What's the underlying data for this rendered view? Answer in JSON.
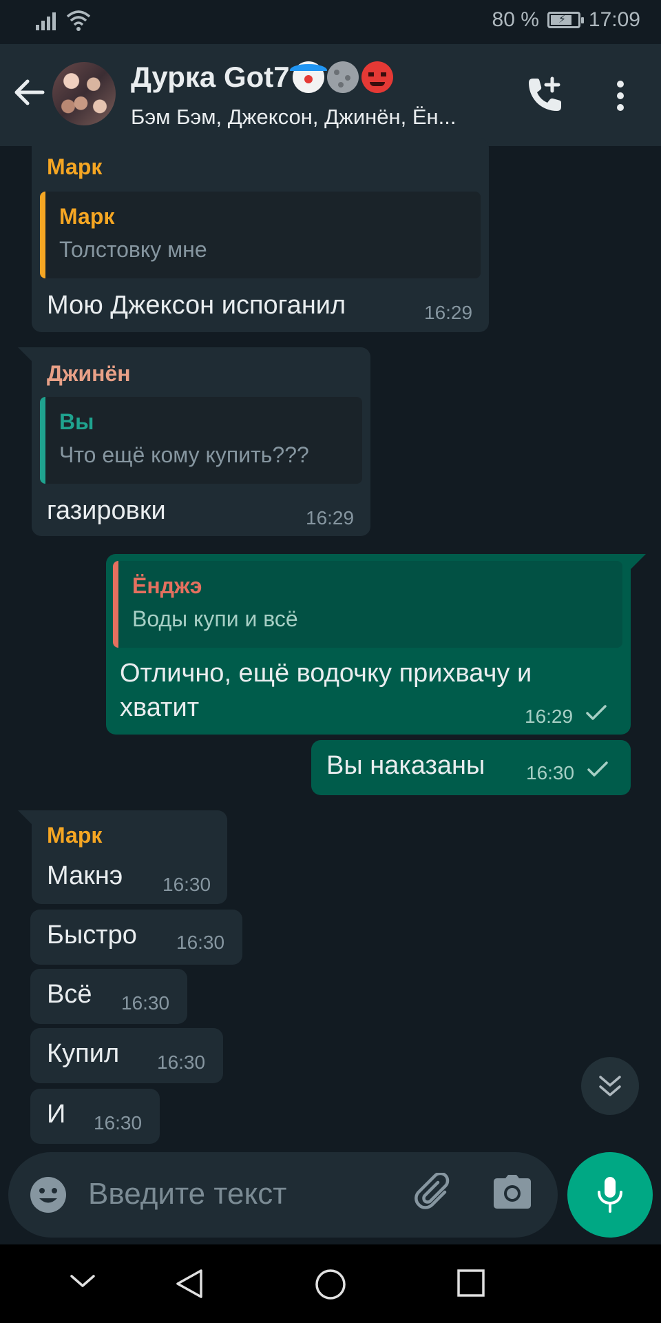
{
  "status_bar": {
    "battery_percent": "80 %",
    "time": "17:09",
    "battery_level": 0.8
  },
  "header": {
    "title": "Дурка Got7",
    "title_emojis": [
      "clown-emoji",
      "new-moon-face-emoji",
      "devil-emoji"
    ],
    "members": "Бэм Бэм, Джексон, Джинён, Ён..."
  },
  "messages": [
    {
      "direction": "in",
      "sender": "Марк",
      "sender_color": "#f5a623",
      "quote": {
        "name": "Марк",
        "name_color": "#f5a623",
        "text": "Толстовку мне",
        "bar_color": "#f5a623"
      },
      "text": "Мою Джексон испоганил",
      "time": "16:29"
    },
    {
      "direction": "in",
      "sender": "Джинён",
      "sender_color": "#e8a087",
      "quote": {
        "name": "Вы",
        "name_color": "#1fa38f",
        "text": "Что ещё кому купить???",
        "bar_color": "#1fa38f"
      },
      "text": "газировки",
      "time": "16:29"
    },
    {
      "direction": "out",
      "quote": {
        "name": "Ёнджэ",
        "name_color": "#e5705f",
        "text": "Воды купи и всё",
        "bar_color": "#e5705f"
      },
      "text_lines": [
        "Отлично, ещё водочку прихвачу и",
        "хватит"
      ],
      "time": "16:29"
    },
    {
      "direction": "out",
      "text": "Вы наказаны",
      "time": "16:30"
    },
    {
      "direction": "in",
      "sender": "Марк",
      "sender_color": "#f5a623",
      "text": "Макнэ",
      "time": "16:30"
    },
    {
      "direction": "in",
      "text": "Быстро",
      "time": "16:30"
    },
    {
      "direction": "in",
      "text": "Всё",
      "time": "16:30"
    },
    {
      "direction": "in",
      "text": "Купил",
      "time": "16:30"
    },
    {
      "direction": "in",
      "text": "И",
      "time": "16:30"
    }
  ],
  "composer": {
    "placeholder": "Введите текст"
  },
  "colors": {
    "background": "#121b22",
    "header": "#1f2c34",
    "incoming": "#1f2c34",
    "outgoing": "#005c4b",
    "accent": "#00a884"
  }
}
